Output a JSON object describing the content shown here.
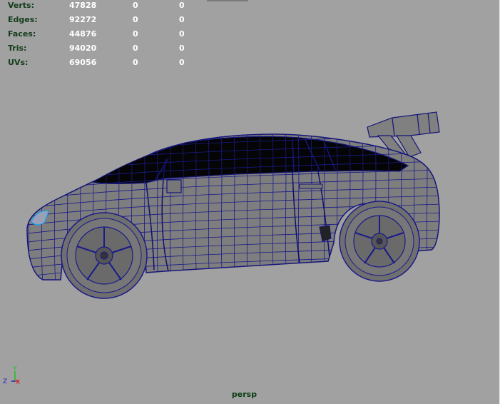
{
  "heads_up": {
    "rows": [
      {
        "label": "Verts:",
        "total": "47828",
        "selected": "0",
        "component": "0"
      },
      {
        "label": "Edges:",
        "total": "92272",
        "selected": "0",
        "component": "0"
      },
      {
        "label": "Faces:",
        "total": "44876",
        "selected": "0",
        "component": "0"
      },
      {
        "label": "Tris:",
        "total": "94020",
        "selected": "0",
        "component": "0"
      },
      {
        "label": "UVs:",
        "total": "69056",
        "selected": "0",
        "component": "0"
      }
    ]
  },
  "axis_gizmo": {
    "y": "Y",
    "z": "Z",
    "x": "X"
  },
  "camera_name": "persp",
  "colors": {
    "viewport_bg": "#a1a1a1",
    "wireframe": "#1a1a8a",
    "body_shade": "#7e7e7e",
    "glass": "#000000",
    "axis_x": "#d02020",
    "axis_y": "#20c020",
    "axis_z": "#2020d0"
  },
  "scene_object": "car-wireframe-model"
}
